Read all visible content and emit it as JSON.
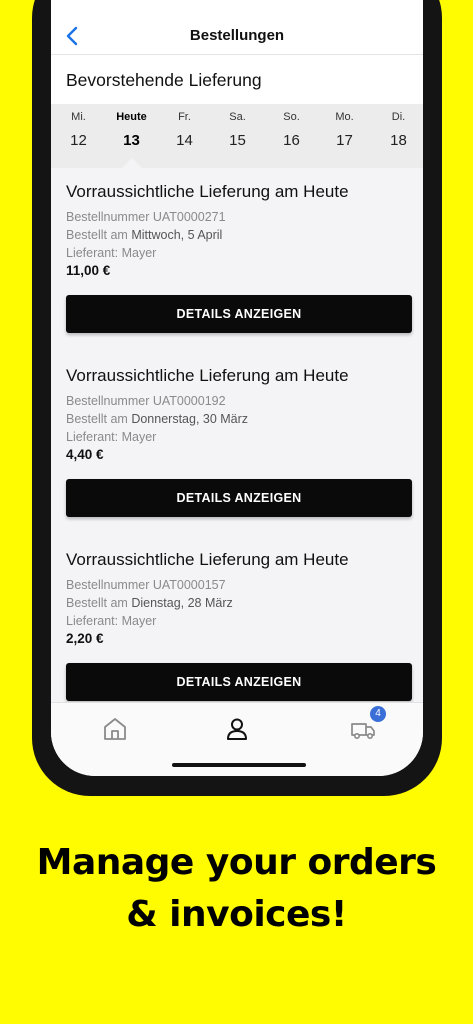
{
  "navbar": {
    "title": "Bestellungen"
  },
  "section_title": "Bevorstehende Lieferung",
  "calendar": [
    {
      "day": "Mi.",
      "date": "12"
    },
    {
      "day": "Heute",
      "date": "13"
    },
    {
      "day": "Fr.",
      "date": "14"
    },
    {
      "day": "Sa.",
      "date": "15"
    },
    {
      "day": "So.",
      "date": "16"
    },
    {
      "day": "Mo.",
      "date": "17"
    },
    {
      "day": "Di.",
      "date": "18"
    }
  ],
  "orders": [
    {
      "heading": "Vorraussichtliche Lieferung am Heute",
      "order_number": "Bestellnummer UAT0000271",
      "ordered_prefix": "Bestellt am",
      "ordered_date": "Mittwoch, 5 April",
      "supplier": "Lieferant: Mayer",
      "price": "11,00 €",
      "button": "DETAILS ANZEIGEN"
    },
    {
      "heading": "Vorraussichtliche Lieferung am Heute",
      "order_number": "Bestellnummer UAT0000192",
      "ordered_prefix": "Bestellt am",
      "ordered_date": "Donnerstag, 30 März",
      "supplier": "Lieferant: Mayer",
      "price": "4,40 €",
      "button": "DETAILS ANZEIGEN"
    },
    {
      "heading": "Vorraussichtliche Lieferung am Heute",
      "order_number": "Bestellnummer UAT0000157",
      "ordered_prefix": "Bestellt am",
      "ordered_date": "Dienstag, 28 März",
      "supplier": "Lieferant: Mayer",
      "price": "2,20 €",
      "button": "DETAILS ANZEIGEN"
    }
  ],
  "tabbar": {
    "icons": [
      "home-icon",
      "profile-icon",
      "truck-icon"
    ],
    "cart_badge": "4"
  },
  "tagline": {
    "line1": "Manage your orders",
    "line2": "& invoices!"
  },
  "colors": {
    "background": "#fffb00",
    "accent": "#1a73e8",
    "badge": "#3a6fd8"
  }
}
